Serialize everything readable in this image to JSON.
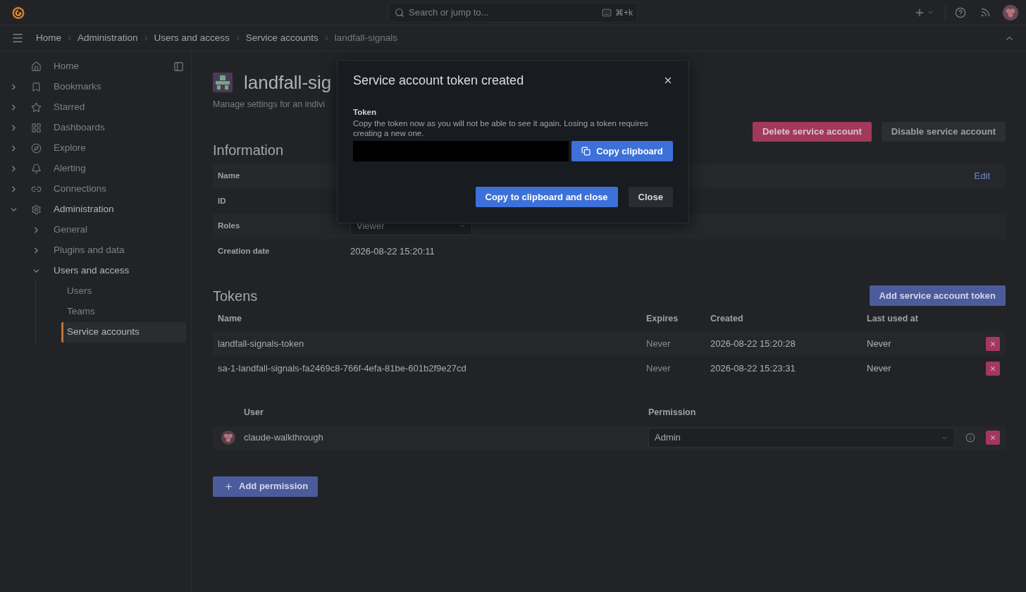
{
  "top_bar": {
    "search": {
      "placeholder": "Search or jump to..."
    },
    "shortcut": "⌘+k"
  },
  "breadcrumbs": [
    {
      "label": "Home",
      "current": false
    },
    {
      "label": "Administration",
      "current": false
    },
    {
      "label": "Users and access",
      "current": false
    },
    {
      "label": "Service accounts",
      "current": false
    },
    {
      "label": "landfall-signals",
      "current": true
    }
  ],
  "sidebar": {
    "items": [
      {
        "label": "Home",
        "selected": false
      },
      {
        "label": "Bookmarks",
        "expanded": false,
        "selected": false
      },
      {
        "label": "Starred",
        "expanded": false,
        "selected": false
      },
      {
        "label": "Dashboards",
        "expanded": false,
        "selected": false
      },
      {
        "label": "Explore",
        "expanded": false,
        "selected": false
      },
      {
        "label": "Alerting",
        "expanded": false,
        "selected": false
      },
      {
        "label": "Connections",
        "expanded": false,
        "selected": false
      },
      {
        "label": "Administration",
        "expanded": true,
        "selected": false,
        "children": [
          {
            "label": "General",
            "expanded": false,
            "selected": false
          },
          {
            "label": "Plugins and data",
            "expanded": false,
            "selected": false
          },
          {
            "label": "Users and access",
            "expanded": true,
            "selected": false,
            "children": [
              {
                "label": "Users",
                "selected": false
              },
              {
                "label": "Teams",
                "selected": false
              },
              {
                "label": "Service accounts",
                "selected": true
              }
            ]
          }
        ]
      }
    ]
  },
  "page": {
    "title": "landfall-sig",
    "subtitle": "Manage settings for an indivi",
    "actions": [
      {
        "label": "Delete service account",
        "kind": "destructive"
      },
      {
        "label": "Disable service account",
        "kind": "secondary"
      }
    ],
    "information": {
      "heading": "Information",
      "rows": [
        {
          "label": "Name",
          "kind": "text",
          "action": "Edit"
        },
        {
          "label": "ID",
          "kind": "text"
        },
        {
          "label": "Roles",
          "kind": "select",
          "value": "Viewer"
        },
        {
          "label": "Creation date",
          "kind": "text",
          "value": "2026-08-22 15:20:11"
        }
      ]
    },
    "tokens": {
      "heading": "Tokens",
      "add_button": "Add service account token",
      "columns": [
        "Name",
        "Expires",
        "Created",
        "Last used at"
      ],
      "rows": [
        {
          "name": "landfall-signals-token",
          "expires": "Never",
          "created": "2026-08-22 15:20:28",
          "last_used": "Never"
        },
        {
          "name": "sa-1-landfall-signals-fa2469c8-766f-4efa-81be-601b2f9e27cd",
          "expires": "Never",
          "created": "2026-08-22 15:23:31",
          "last_used": "Never"
        }
      ]
    },
    "permissions": {
      "columns": [
        "User",
        "Permission"
      ],
      "rows": [
        {
          "user": "claude-walkthrough",
          "permission": "Admin"
        }
      ],
      "add_button": "Add permission"
    }
  },
  "dialog": {
    "title": "Service account token created",
    "field": {
      "label": "Token",
      "description": "Copy the token now as you will not be able to see it again. Losing a token requires creating a new one."
    },
    "copy_button": "Copy clipboard",
    "buttons": [
      {
        "label": "Copy to clipboard and close",
        "kind": "primary"
      },
      {
        "label": "Close",
        "kind": "secondary"
      }
    ]
  }
}
